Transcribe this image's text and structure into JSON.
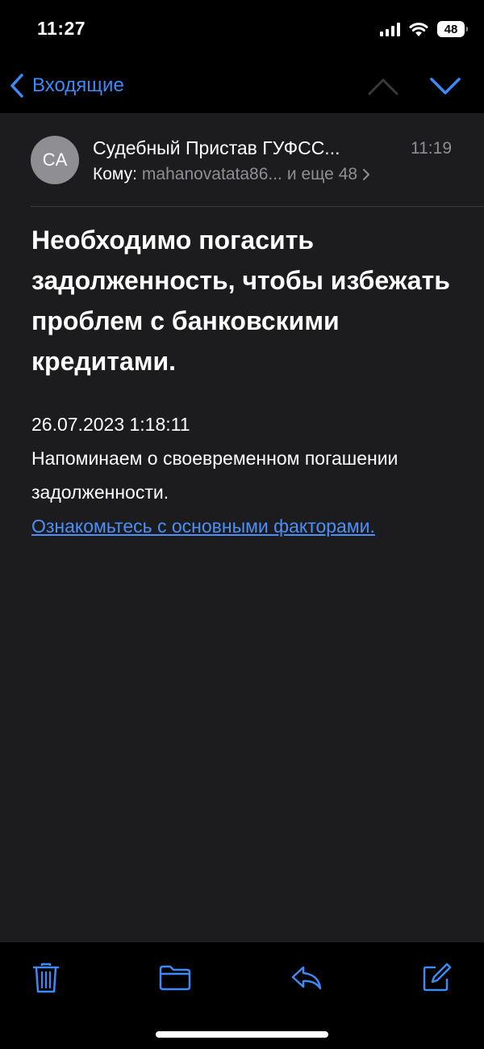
{
  "status_bar": {
    "time": "11:27",
    "battery": "48"
  },
  "nav": {
    "back_label": "Входящие"
  },
  "message": {
    "avatar_initials": "CA",
    "sender": "Судебный Пристав ГУФСС...",
    "time": "11:19",
    "to_label": "Кому:",
    "to_address": "mahanovatata86...",
    "to_more": "и еще 48",
    "subject": "Необходимо погасить задолженность, чтобы избежать проблем с банковскими кредитами.",
    "body_date": "26.07.2023 1:18:11",
    "body_text": "Напоминаем о своевременном погашении задолженности.",
    "body_link": "Ознакомьтесь с основными факторами."
  },
  "toolbar": {
    "items": [
      {
        "icon": "trash-icon"
      },
      {
        "icon": "folder-icon"
      },
      {
        "icon": "reply-icon"
      },
      {
        "icon": "compose-icon"
      }
    ]
  },
  "colors": {
    "accent": "#3d8af7",
    "background": "#1c1c1e",
    "secondary_text": "#8e8e93"
  }
}
